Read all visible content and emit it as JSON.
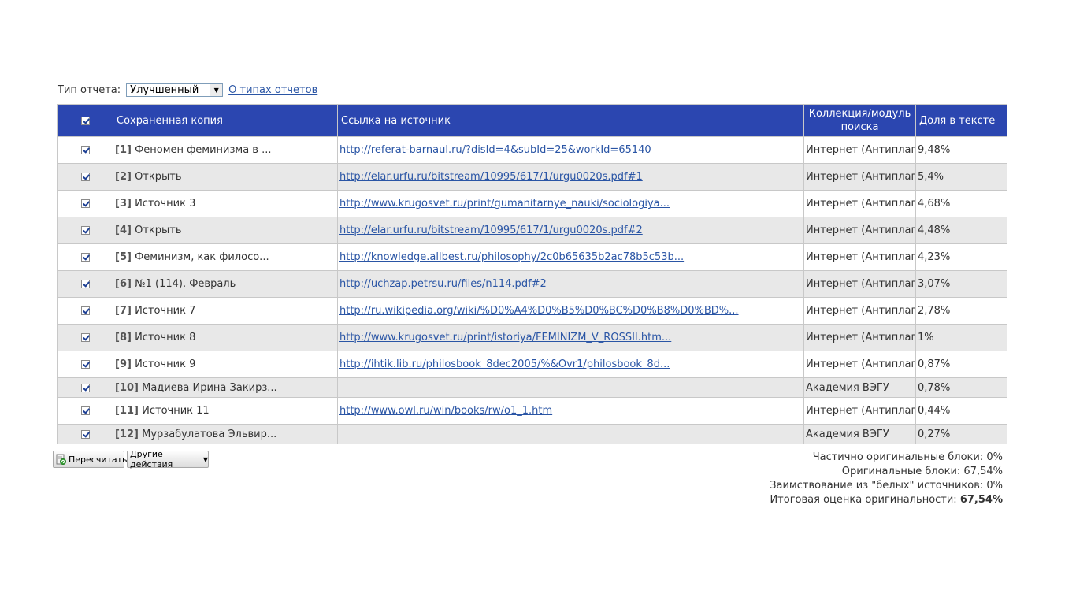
{
  "report_type": {
    "label": "Тип отчета:",
    "selected": "Улучшенный",
    "about_link": "О типах отчетов"
  },
  "table": {
    "headers": {
      "copy": "Сохраненная копия",
      "url": "Ссылка на источник",
      "collection": "Коллекция/модуль поиска",
      "share": "Доля в тексте"
    },
    "rows": [
      {
        "num": "[1]",
        "name": "Феномен феминизма в ...",
        "url": "http://referat-barnaul.ru/?disId=4&subId=25&workId=65140",
        "collection": "Интернет (Антиплагиат)",
        "share": "9,48%"
      },
      {
        "num": "[2]",
        "name": "Открыть",
        "url": "http://elar.urfu.ru/bitstream/10995/617/1/urgu0020s.pdf#1",
        "collection": "Интернет (Антиплагиат)",
        "share": "5,4%"
      },
      {
        "num": "[3]",
        "name": "Источник 3",
        "url": "http://www.krugosvet.ru/print/gumanitarnye_nauki/sociologiya...",
        "collection": "Интернет (Антиплагиат)",
        "share": "4,68%"
      },
      {
        "num": "[4]",
        "name": "Открыть",
        "url": "http://elar.urfu.ru/bitstream/10995/617/1/urgu0020s.pdf#2",
        "collection": "Интернет (Антиплагиат)",
        "share": "4,48%"
      },
      {
        "num": "[5]",
        "name": "Феминизм, как филосо...",
        "url": "http://knowledge.allbest.ru/philosophy/2c0b65635b2ac78b5c53b...",
        "collection": "Интернет (Антиплагиат)",
        "share": "4,23%"
      },
      {
        "num": "[6]",
        "name": "№1 (114). Февраль",
        "url": "http://uchzap.petrsu.ru/files/n114.pdf#2",
        "collection": "Интернет (Антиплагиат)",
        "share": "3,07%"
      },
      {
        "num": "[7]",
        "name": "Источник 7",
        "url": "http://ru.wikipedia.org/wiki/%D0%A4%D0%B5%D0%BC%D0%B8%D0%BD%...",
        "collection": "Интернет (Антиплагиат)",
        "share": "2,78%"
      },
      {
        "num": "[8]",
        "name": "Источник 8",
        "url": "http://www.krugosvet.ru/print/istoriya/FEMINIZM_V_ROSSII.htm...",
        "collection": "Интернет (Антиплагиат)",
        "share": "1%"
      },
      {
        "num": "[9]",
        "name": "Источник 9",
        "url": "http://ihtik.lib.ru/philosbook_8dec2005/%&Ovr1/philosbook_8d...",
        "collection": "Интернет (Антиплагиат)",
        "share": "0,87%"
      },
      {
        "num": "[10]",
        "name": "Мадиева Ирина Закирз...",
        "url": "",
        "collection": "Академия ВЭГУ",
        "share": "0,78%"
      },
      {
        "num": "[11]",
        "name": "Источник 11",
        "url": "http://www.owl.ru/win/books/rw/o1_1.htm",
        "collection": "Интернет (Антиплагиат)",
        "share": "0,44%"
      },
      {
        "num": "[12]",
        "name": "Мурзабулатова Эльвир...",
        "url": "",
        "collection": "Академия ВЭГУ",
        "share": "0,27%"
      }
    ]
  },
  "buttons": {
    "recalc": "Пересчитать",
    "other_actions": "Другие действия"
  },
  "summary": {
    "partial_original": "Частично оригинальные блоки: 0%",
    "original": "Оригинальные блоки: 67,54%",
    "white_sources": "Заимствование из \"белых\" источников: 0%",
    "total_label": "Итоговая оценка оригинальности:",
    "total_value": "67,54%"
  },
  "colors": {
    "header_bg": "#2b46b0",
    "link": "#2a55a5",
    "zebra": "#e8e8e8"
  }
}
